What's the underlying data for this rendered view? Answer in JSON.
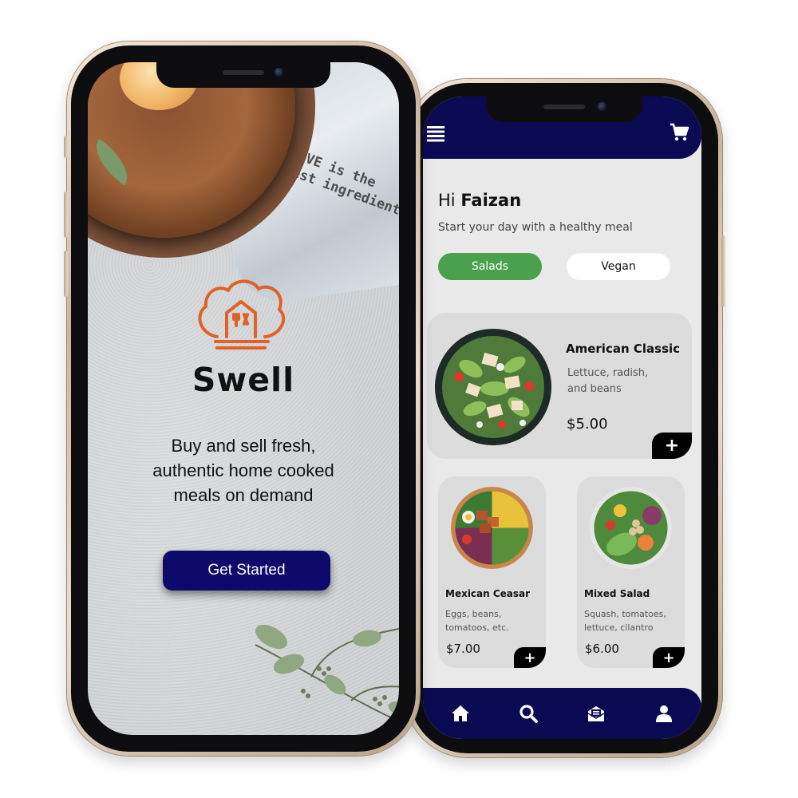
{
  "welcome_screen": {
    "decor_text": [
      "LOVE is the",
      "best ingredient"
    ],
    "brand_name": "Swell",
    "tagline": [
      "Buy and sell fresh,",
      "authentic home cooked",
      "meals on demand"
    ],
    "cta_label": "Get Started",
    "colors": {
      "cta": "#0d0a6b",
      "logo": "#e0612a"
    }
  },
  "menu_screen": {
    "header": {
      "left_icon": "hamburger-menu-icon",
      "right_icon": "shopping-cart-icon"
    },
    "greeting_prefix": "Hi ",
    "user_name": "Faizan",
    "subtitle": "Start your day with a healthy meal",
    "categories": [
      {
        "label": "Salads",
        "active": true
      },
      {
        "label": "Vegan",
        "active": false
      }
    ],
    "items": [
      {
        "name": "American Classic",
        "description": [
          "Lettuce, radish,",
          "and beans"
        ],
        "price": "$5.00",
        "add_label": "+"
      },
      {
        "name": "Mexican Ceasar",
        "description": [
          "Eggs, beans,",
          "tomatoos, etc."
        ],
        "price": "$7.00",
        "add_label": "+"
      },
      {
        "name": "Mixed Salad",
        "description": [
          "Squash, tomatoes,",
          "lettuce, cilantro"
        ],
        "price": "$6.00",
        "add_label": "+"
      }
    ],
    "bottom_nav": [
      "home-icon",
      "search-icon",
      "orders-icon",
      "profile-icon"
    ],
    "colors": {
      "navy": "#0a0a52",
      "active_chip": "#4aa04d"
    }
  }
}
